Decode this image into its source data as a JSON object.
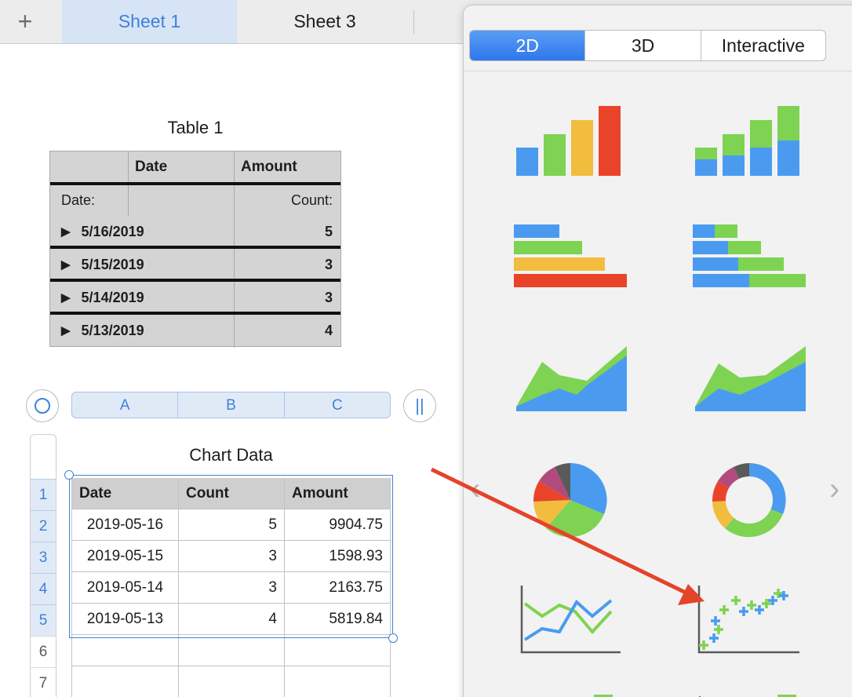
{
  "tabs": {
    "add_label": "+",
    "sheet1": "Sheet 1",
    "sheet3": "Sheet 3"
  },
  "table1": {
    "title": "Table 1",
    "headers": [
      "Date",
      "Amount"
    ],
    "sub_left": "Date:",
    "sub_right": "Count:",
    "groups": [
      {
        "date": "5/16/2019",
        "count": "5"
      },
      {
        "date": "5/15/2019",
        "count": "3"
      },
      {
        "date": "5/14/2019",
        "count": "3"
      },
      {
        "date": "5/13/2019",
        "count": "4"
      }
    ]
  },
  "columns": [
    "A",
    "B",
    "C"
  ],
  "chart_table": {
    "title": "Chart Data",
    "headers": [
      "Date",
      "Count",
      "Amount"
    ],
    "rows": [
      [
        "2019-05-16",
        "5",
        "9904.75"
      ],
      [
        "2019-05-15",
        "3",
        "1598.93"
      ],
      [
        "2019-05-14",
        "3",
        "2163.75"
      ],
      [
        "2019-05-13",
        "4",
        "5819.84"
      ]
    ],
    "row_numbers": [
      "1",
      "2",
      "3",
      "4",
      "5",
      "6",
      "7"
    ]
  },
  "popover": {
    "segments": [
      "2D",
      "3D",
      "Interactive"
    ],
    "active_segment": "2D",
    "chart_types": [
      "column-chart-icon",
      "stacked-column-chart-icon",
      "bar-chart-icon",
      "stacked-bar-chart-icon",
      "area-chart-icon",
      "stacked-area-chart-icon",
      "pie-chart-icon",
      "donut-chart-icon",
      "line-chart-icon",
      "scatter-chart-icon"
    ],
    "prev_glyph": "‹",
    "next_glyph": "›"
  },
  "colors": {
    "accent": "#3e82d8",
    "blue": "#4a9bf0",
    "green": "#7ed352",
    "yellow": "#f2bc3f",
    "red": "#e9442a",
    "arrow": "#e5432a"
  }
}
